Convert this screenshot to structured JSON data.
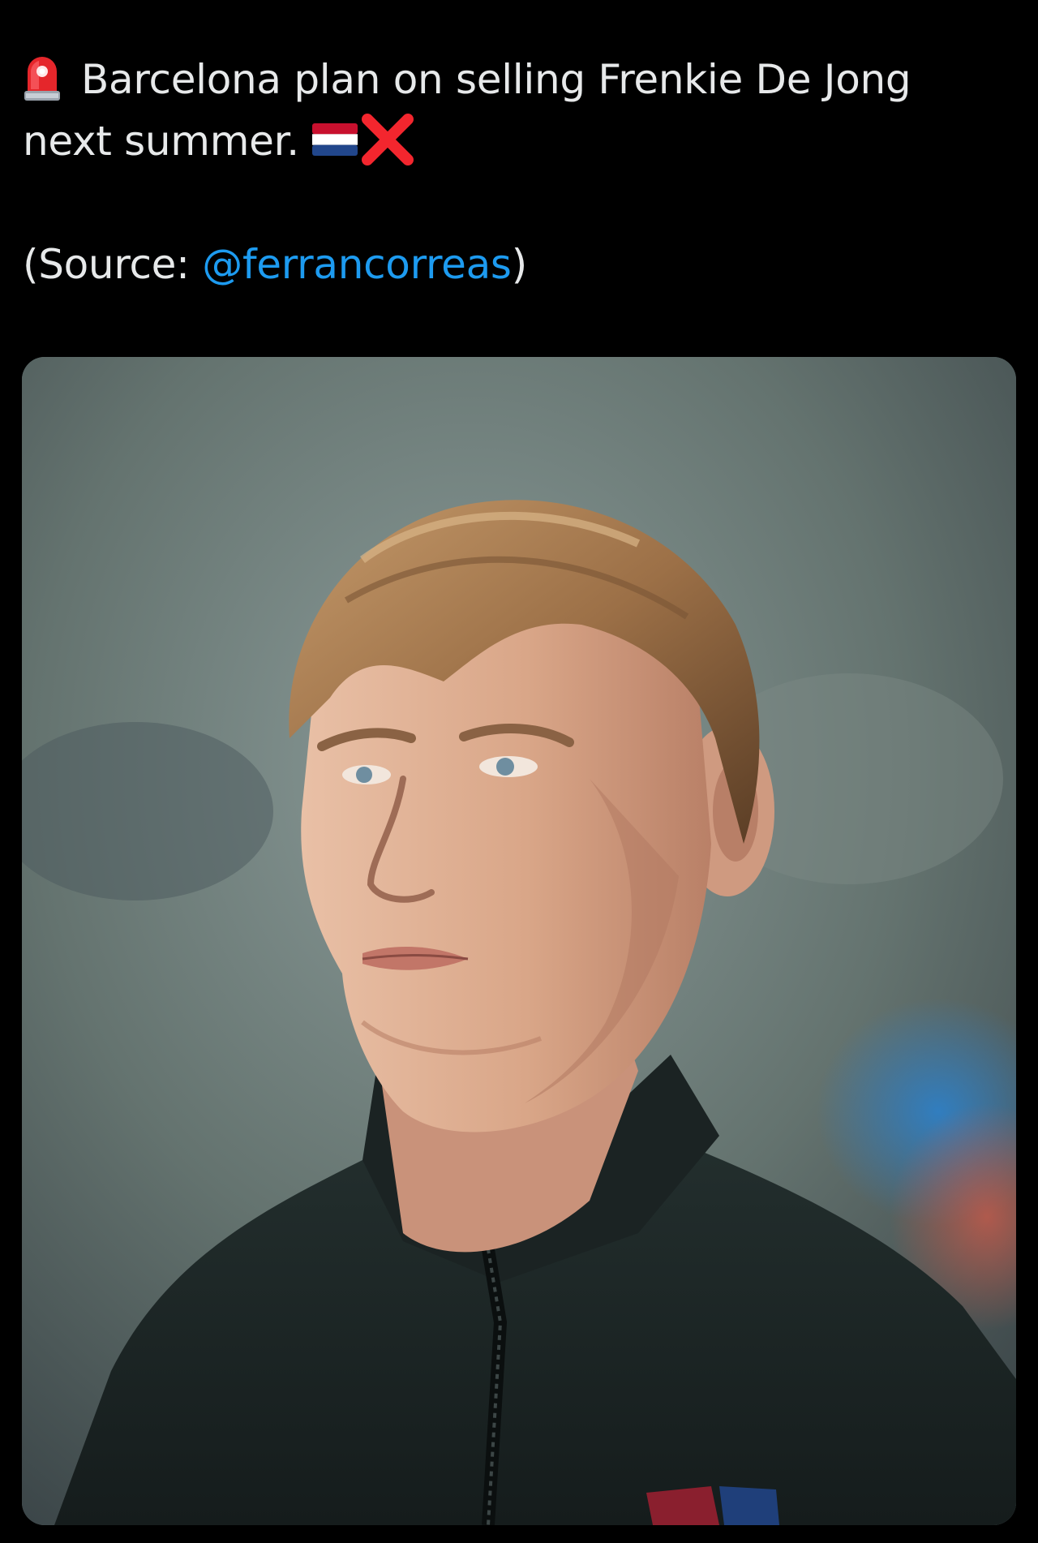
{
  "tweet": {
    "line1": "Barcelona plan on selling Frenkie De Jong",
    "line2": "next summer.",
    "source_prefix": "(Source: ",
    "source_mention": "@ferrancorreas",
    "source_suffix": ")",
    "icons": [
      "police-siren-icon",
      "netherlands-flag-icon",
      "red-cross-icon"
    ]
  },
  "colors": {
    "background": "#000000",
    "text": "#e7e9ea",
    "mention": "#1d9bf0"
  },
  "media": {
    "description_icon": "player-photo"
  }
}
